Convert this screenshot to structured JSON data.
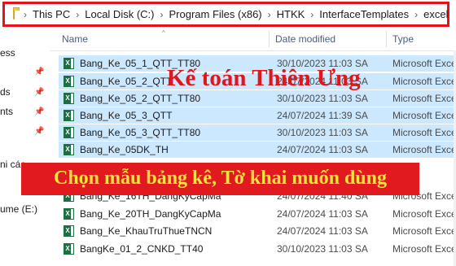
{
  "address_bar": {
    "crumbs": [
      "This PC",
      "Local Disk (C:)",
      "Program Files (x86)",
      "HTKK",
      "InterfaceTemplates",
      "excel"
    ]
  },
  "nav": {
    "items": [
      "ess",
      "ds",
      "nts",
      "ni các",
      "ume (E:)"
    ]
  },
  "columns": {
    "name": "Name",
    "date_modified": "Date modified",
    "type": "Type"
  },
  "files": [
    {
      "name": "Bang_Ke_05_1_QTT_TT80",
      "date": "30/10/2023 11:03 SA",
      "type": "Microsoft Exce",
      "selected": true
    },
    {
      "name": "Bang_Ke_05_2_QTT",
      "date": "24/07/2024 11:03 SA",
      "type": "Microsoft Exce",
      "selected": true
    },
    {
      "name": "Bang_Ke_05_2_QTT_TT80",
      "date": "30/10/2023 11:03 SA",
      "type": "Microsoft Exce",
      "selected": true
    },
    {
      "name": "Bang_Ke_05_3_QTT",
      "date": "24/07/2024 11:39 SA",
      "type": "Microsoft Exce",
      "selected": true
    },
    {
      "name": "Bang_Ke_05_3_QTT_TT80",
      "date": "30/10/2023 11:03 SA",
      "type": "Microsoft Exce",
      "selected": true
    },
    {
      "name": "Bang_Ke_05DK_TH",
      "date": "24/07/2024 11:03 SA",
      "type": "Microsoft Exce",
      "selected": true
    },
    {
      "name": "Bang_Ke_16TH_DangKyCapMa",
      "date": "24/07/2024 11:40 SA",
      "type": "Microsoft Exce",
      "selected": false
    },
    {
      "name": "Bang_Ke_20TH_DangKyCapMa",
      "date": "24/07/2024 11:03 SA",
      "type": "Microsoft Exce",
      "selected": false
    },
    {
      "name": "Bang_Ke_KhauTruThueTNCN",
      "date": "24/07/2024 11:03 SA",
      "type": "Microsoft Exce",
      "selected": false
    },
    {
      "name": "BangKe_01_2_CNKD_TT40",
      "date": "30/10/2023 11:03 SA",
      "type": "Microsoft Exce",
      "selected": false
    }
  ],
  "overlays": {
    "watermark": "Kế toán Thiên Ưng",
    "banner": "Chọn mẫu bảng kê, Tờ khai muốn dùng"
  },
  "colors": {
    "highlight_border": "#e8101a",
    "selection": "#cce8ff",
    "banner_bg": "#e11a1f",
    "banner_text": "#f6e23a",
    "watermark_text": "#e2151a"
  }
}
